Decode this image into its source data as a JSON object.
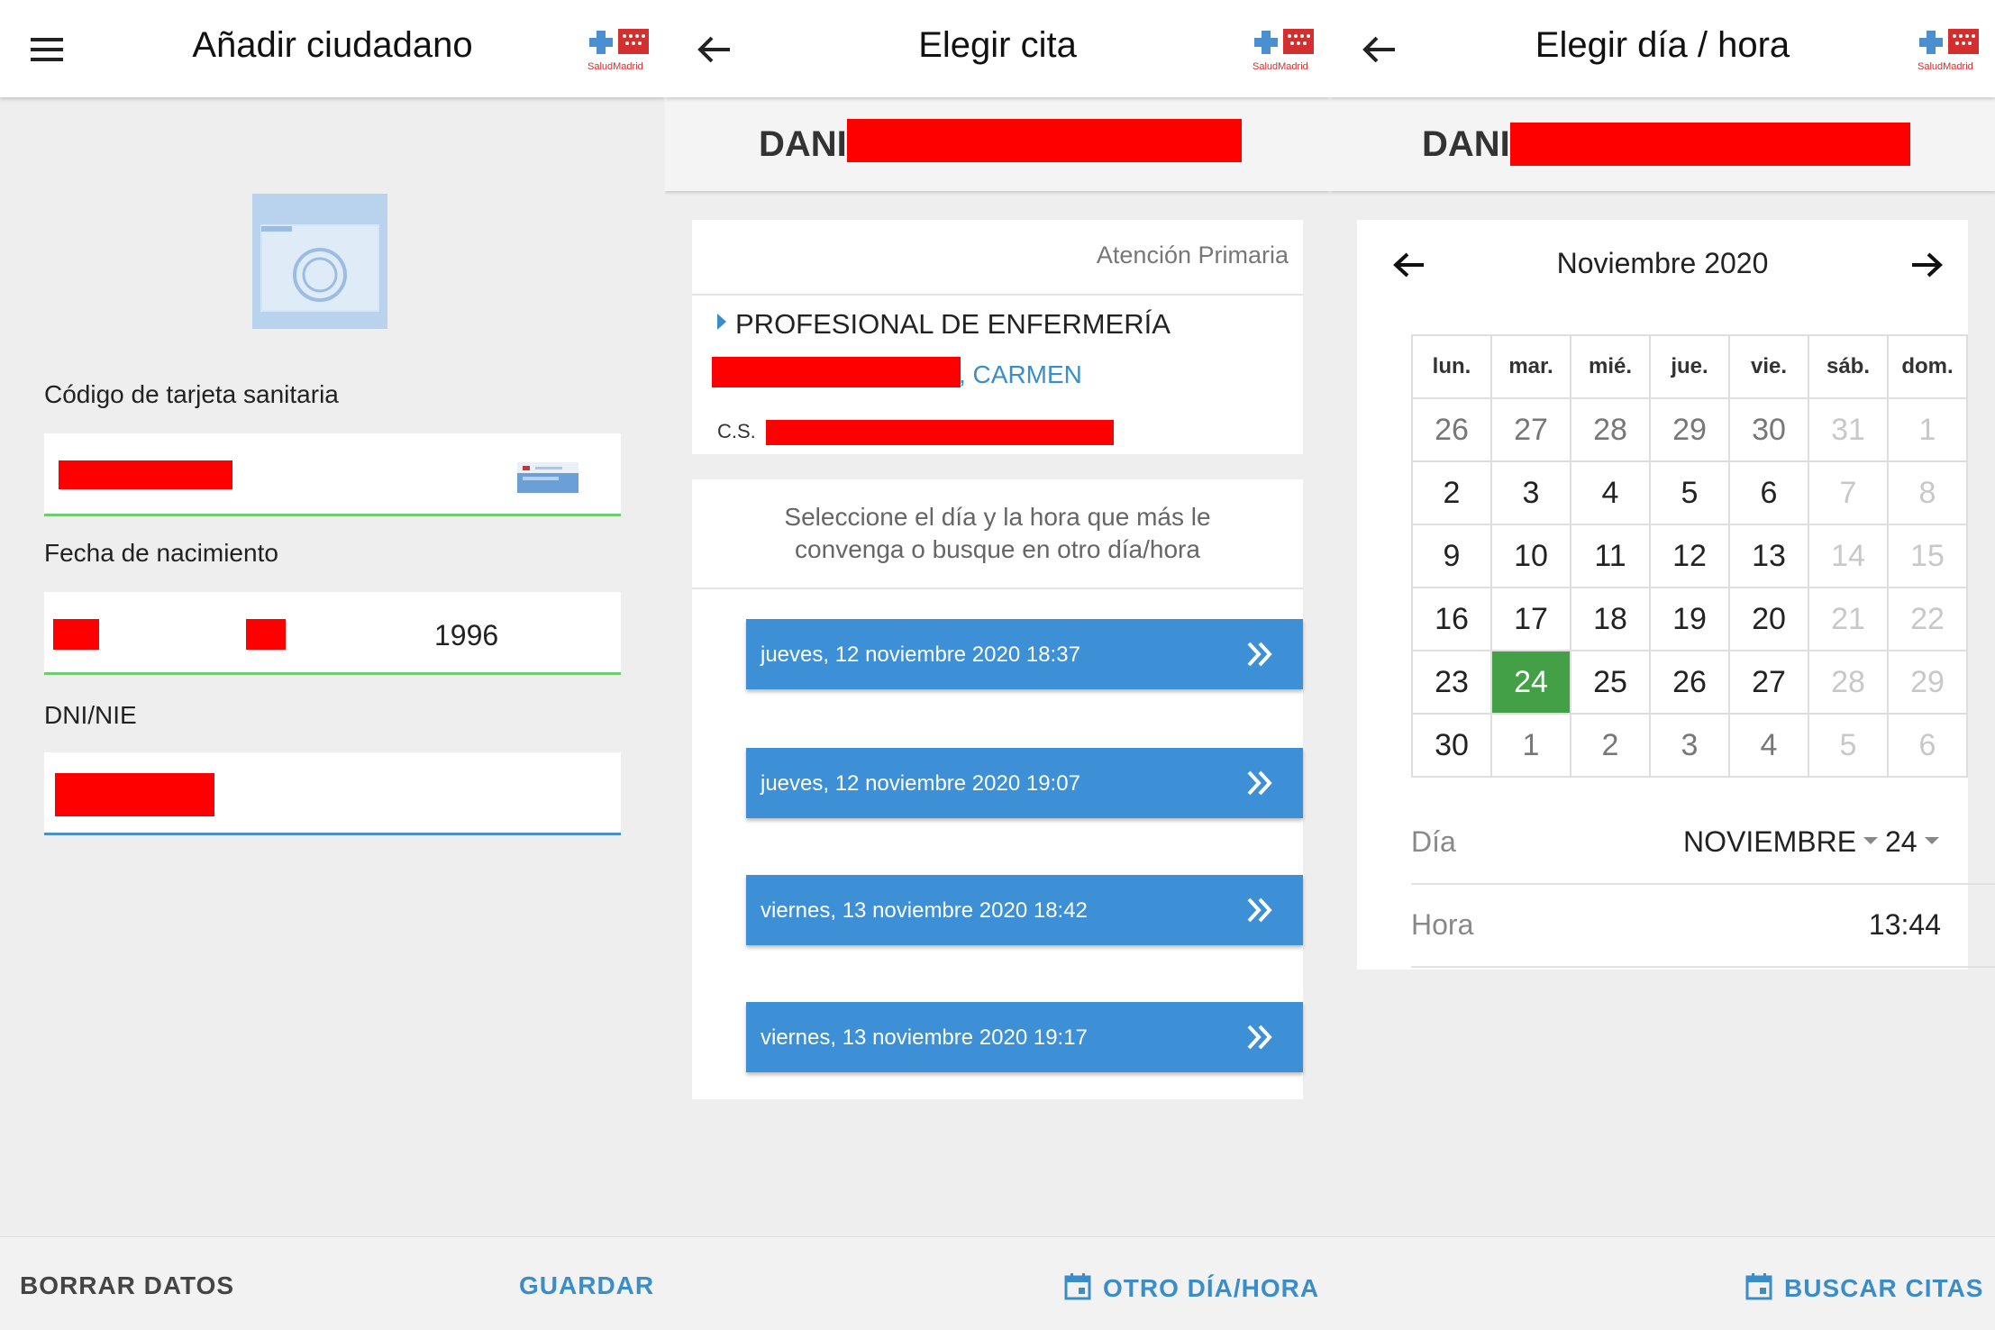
{
  "colors": {
    "primary_blue": "#3d8fd6",
    "selected_green": "#43a047",
    "field_ok_green": "#6ccf6c",
    "redaction_red": "#ff0000"
  },
  "screen1": {
    "title": "Añadir ciudadano",
    "logo_text": "SaludMadrid",
    "label_card": "Código de tarjeta sanitaria",
    "label_birth": "Fecha de nacimiento",
    "birth_year": "1996",
    "label_dni": "DNI/NIE"
  },
  "screen2": {
    "title": "Elegir cita",
    "logo_text": "SaludMadrid",
    "citizen_name": "DANI",
    "service": "Atención Primaria",
    "professional_type": "PROFESIONAL DE ENFERMERÍA",
    "professional_name_suffix": ", CARMEN",
    "center_prefix": "C.S.",
    "instructions": "Seleccione el día y la hora que más le convenga o busque en otro día/hora",
    "appointments": [
      "jueves, 12 noviembre 2020 18:37",
      "jueves, 12 noviembre 2020 19:07",
      "viernes, 13 noviembre 2020 18:42",
      "viernes, 13 noviembre 2020 19:17"
    ]
  },
  "screen3": {
    "title": "Elegir día / hora",
    "logo_text": "SaludMadrid",
    "citizen_name": "DANI",
    "month_label": "Noviembre 2020",
    "weekdays": [
      "lun.",
      "mar.",
      "mié.",
      "jue.",
      "vie.",
      "sáb.",
      "dom."
    ],
    "weeks": [
      [
        "26",
        "27",
        "28",
        "29",
        "30",
        "31",
        "1"
      ],
      [
        "2",
        "3",
        "4",
        "5",
        "6",
        "7",
        "8"
      ],
      [
        "9",
        "10",
        "11",
        "12",
        "13",
        "14",
        "15"
      ],
      [
        "16",
        "17",
        "18",
        "19",
        "20",
        "21",
        "22"
      ],
      [
        "23",
        "24",
        "25",
        "26",
        "27",
        "28",
        "29"
      ],
      [
        "30",
        "1",
        "2",
        "3",
        "4",
        "5",
        "6"
      ]
    ],
    "selected_day": "24",
    "day_label": "Día",
    "month_select": "NOVIEMBRE",
    "day_select": "24",
    "hour_label": "Hora",
    "hour_value": "13:44"
  },
  "footer": {
    "clear_label": "BORRAR DATOS",
    "save_label": "GUARDAR",
    "other_label": "OTRO DÍA/HORA",
    "search_label": "BUSCAR CITAS"
  }
}
